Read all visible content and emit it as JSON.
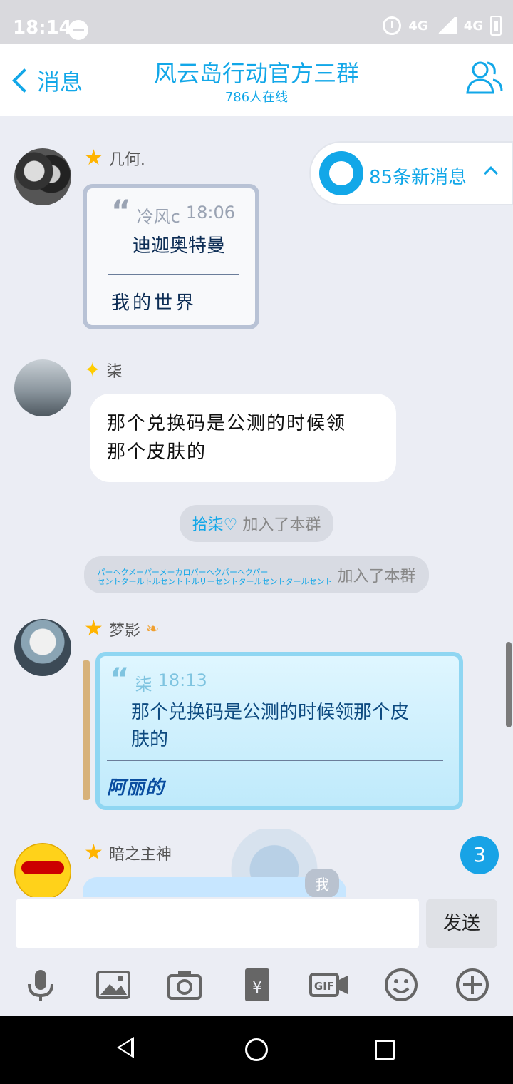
{
  "status_bar": {
    "time": "18:14",
    "network": "4G",
    "network2": "4G"
  },
  "header": {
    "back_label": "消息",
    "title": "风云岛行动官方三群",
    "subtitle": "786人在线"
  },
  "new_messages": {
    "label": "85条新消息"
  },
  "messages": [
    {
      "sender": "几何.",
      "quote_author": "冷风c",
      "quote_time": "18:06",
      "quote_text": "迪迦奥特曼",
      "reply": "我的世界"
    },
    {
      "sender": "柒",
      "text_line1": "那个兑换码是公测的时候领",
      "text_line2": "那个皮肤的"
    },
    {
      "sender": "梦影",
      "quote_author": "柒",
      "quote_time": "18:13",
      "quote_text_line1": "那个兑换码是公测的时候领那个皮",
      "quote_text_line2": "肤的",
      "reply": "阿丽的"
    },
    {
      "sender": "暗之主神",
      "tag": "我"
    }
  ],
  "system": {
    "join1_name": "拾柒",
    "join1_text": "加入了本群",
    "join2_name_line1": "パーヘクメーパーメーカロパーヘクパーヘクパー",
    "join2_name_line2": "セントタールトルセントトルリーセントタールセントタールセント",
    "join2_text": "加入了本群"
  },
  "unread_count": "3",
  "input": {
    "placeholder": "",
    "send_label": "发送"
  },
  "toolbar": [
    "mic-icon",
    "image-icon",
    "camera-icon",
    "red-packet-icon",
    "gif-icon",
    "emoji-icon",
    "plus-icon"
  ],
  "colors": {
    "accent": "#12a7e8",
    "background": "#ebedf4"
  }
}
